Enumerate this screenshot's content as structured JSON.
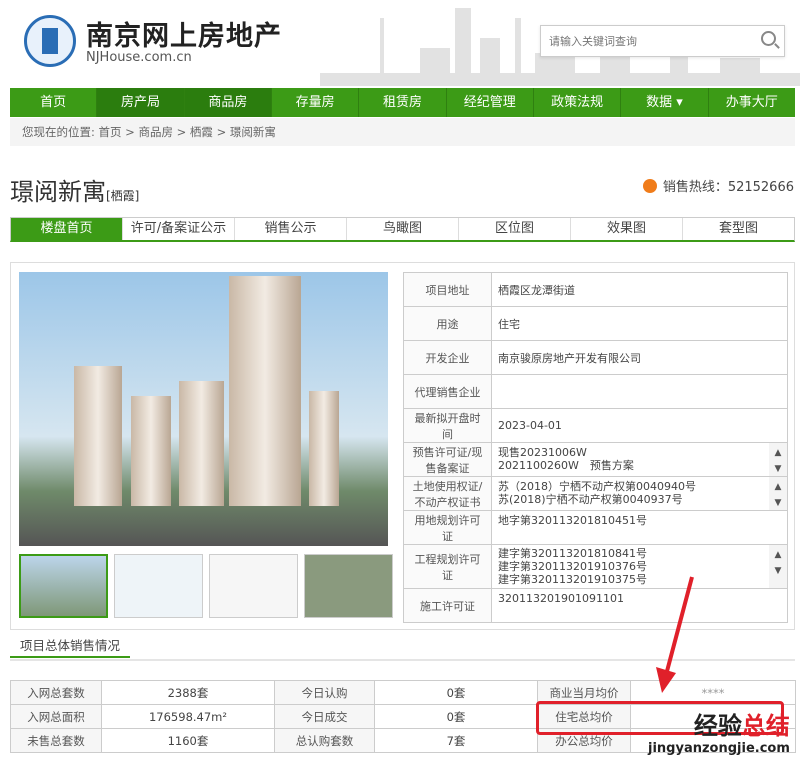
{
  "header": {
    "site_title": "南京网上房地产",
    "site_url": "NJHouse.com.cn",
    "search_placeholder": "请输入关键词查询"
  },
  "nav": [
    "首页",
    "房产局",
    "商品房",
    "存量房",
    "租赁房",
    "经纪管理",
    "政策法规",
    "数据 ▾",
    "办事大厅"
  ],
  "breadcrumb": "您现在的位置: 首页 > 商品房 > 栖霞 > 璟阅新寓",
  "project": {
    "name": "璟阅新寓",
    "district": "[栖霞]",
    "hotline": "销售热线：52152666"
  },
  "tabs": [
    "楼盘首页",
    "许可/备案证公示",
    "销售公示",
    "鸟瞰图",
    "区位图",
    "效果图",
    "套型图"
  ],
  "info": [
    {
      "k": "项目地址",
      "v": "栖霞区龙潭街道"
    },
    {
      "k": "用途",
      "v": "住宅"
    },
    {
      "k": "开发企业",
      "v": "南京骏原房地产开发有限公司"
    },
    {
      "k": "代理销售企业",
      "v": ""
    },
    {
      "k": "最新拟开盘时间",
      "v": "2023-04-01"
    }
  ],
  "info_multi": [
    {
      "k": "预售许可证/现售备案证",
      "lines": [
        "现售20231006W",
        "2021100260W　预售方案"
      ]
    },
    {
      "k": "土地使用权证/不动产权证书",
      "lines": [
        "苏（2018）宁栖不动产权第0040940号",
        "苏(2018)宁栖不动产权第0040937号"
      ]
    },
    {
      "k": "用地规划许可证",
      "lines": [
        "地字第320113201810451号"
      ]
    },
    {
      "k": "工程规划许可证",
      "lines": [
        "建字第320113201810841号",
        "建字第320113201910376号",
        "建字第320113201910375号"
      ]
    },
    {
      "k": "施工许可证",
      "lines": [
        "320113201901091101"
      ]
    }
  ],
  "section_title": "项目总体销售情况",
  "sales": [
    [
      "入网总套数",
      "2388套",
      "今日认购",
      "0套",
      "商业当月均价",
      "****"
    ],
    [
      "入网总面积",
      "176598.47m²",
      "今日成交",
      "0套",
      "住宅总均价",
      ""
    ],
    [
      "未售总套数",
      "1160套",
      "总认购套数",
      "7套",
      "办公总均价",
      ""
    ]
  ],
  "watermark": {
    "title_a": "经验",
    "title_b": "总结",
    "url": "jingyanzongjie.com"
  },
  "colors": {
    "brand_green": "#3c9b16",
    "highlight_red": "#e0202a"
  }
}
